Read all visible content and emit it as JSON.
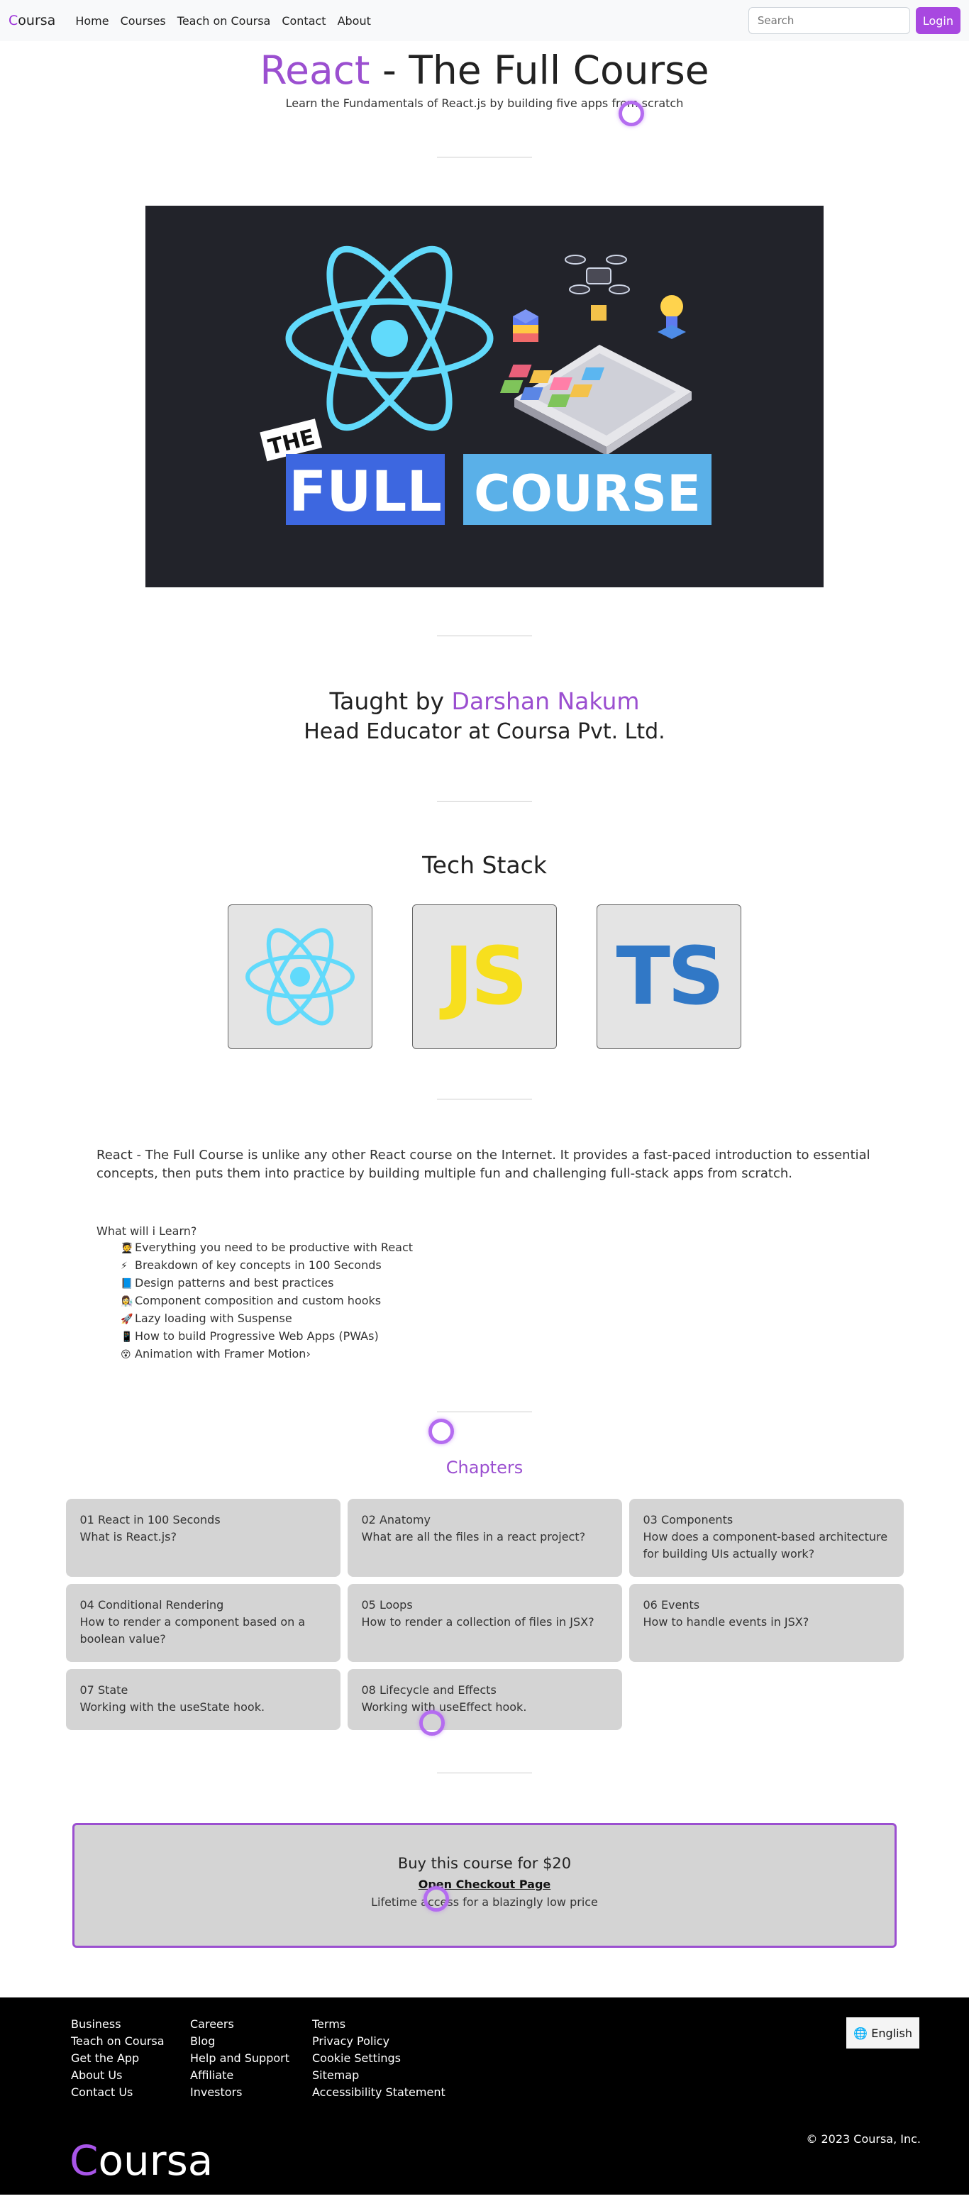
{
  "nav": {
    "brand_first": "C",
    "brand_rest": "oursa",
    "links": [
      "Home",
      "Courses",
      "Teach on Coursa",
      "Contact",
      "About"
    ],
    "search_placeholder": "Search",
    "login_label": "Login"
  },
  "hero": {
    "title_accent": "React",
    "title_rest": " - The Full Course",
    "subtitle": "Learn the Fundamentals of React.js by building five apps from scratch"
  },
  "banner": {
    "the": "THE",
    "full": "FULL",
    "course": "COURSE"
  },
  "instructor": {
    "prefix": "Taught by ",
    "name": "Darshan Nakum",
    "role": "Head Educator at Coursa Pvt. Ltd."
  },
  "tech": {
    "title": "Tech Stack",
    "items": [
      "react-logo",
      "JS",
      "TS"
    ]
  },
  "description": "React - The Full Course is unlike any other React course on the Internet. It provides a fast-paced introduction to essential concepts, then puts them into practice by building multiple fun and challenging full-stack apps from scratch.",
  "learn": {
    "title": "What will i Learn?",
    "items": [
      {
        "icon": "🧑‍🎓",
        "text": "Everything you need to be productive with React"
      },
      {
        "icon": "⚡",
        "text": "Breakdown of key concepts in 100 Seconds"
      },
      {
        "icon": "📘",
        "text": "Design patterns and best practices"
      },
      {
        "icon": "👩‍🔬",
        "text": "Component composition and custom hooks"
      },
      {
        "icon": "🚀",
        "text": "Lazy loading with Suspense"
      },
      {
        "icon": "📱",
        "text": "How to build Progressive Web Apps (PWAs)"
      },
      {
        "icon": "😵",
        "text": "Animation with Framer Motion›"
      }
    ]
  },
  "chapters": {
    "title": "Chapters",
    "items": [
      {
        "num_title": "01 React in 100 Seconds",
        "desc": "What is React.js?"
      },
      {
        "num_title": "02 Anatomy",
        "desc": "What are all the files in a react project?"
      },
      {
        "num_title": "03 Components",
        "desc": "How does a component-based architecture for building UIs actually work?"
      },
      {
        "num_title": "04 Conditional Rendering",
        "desc": "How to render a component based on a boolean value?"
      },
      {
        "num_title": "05 Loops",
        "desc": "How to render a collection of files in JSX?"
      },
      {
        "num_title": "06 Events",
        "desc": "How to handle events in JSX?"
      },
      {
        "num_title": "07 State",
        "desc": "Working with the useState hook."
      },
      {
        "num_title": "08 Lifecycle and Effects",
        "desc": "Working with useEffect hook."
      }
    ]
  },
  "buy": {
    "title": "Buy this course for $20",
    "link": "Open Checkout Page",
    "note": "Lifetime access for a blazingly low price"
  },
  "footer": {
    "col1": [
      "Business",
      "Teach on Coursa",
      "Get the App",
      "About Us",
      "Contact Us"
    ],
    "col2": [
      "Careers",
      "Blog",
      "Help and Support",
      "Affiliate",
      "Investors"
    ],
    "col3": [
      "Terms",
      "Privacy Policy",
      "Cookie Settings",
      "Sitemap",
      "Accessibility Statement"
    ],
    "language": "English",
    "copyright": "© 2023 Coursa, Inc.",
    "logo_first": "C",
    "logo_rest": "oursa"
  },
  "colors": {
    "accent": "#9b4fd0",
    "login": "#a848e0",
    "react_blue": "#61dafb",
    "js_yellow": "#f7df1e",
    "ts_blue": "#3178c6"
  }
}
